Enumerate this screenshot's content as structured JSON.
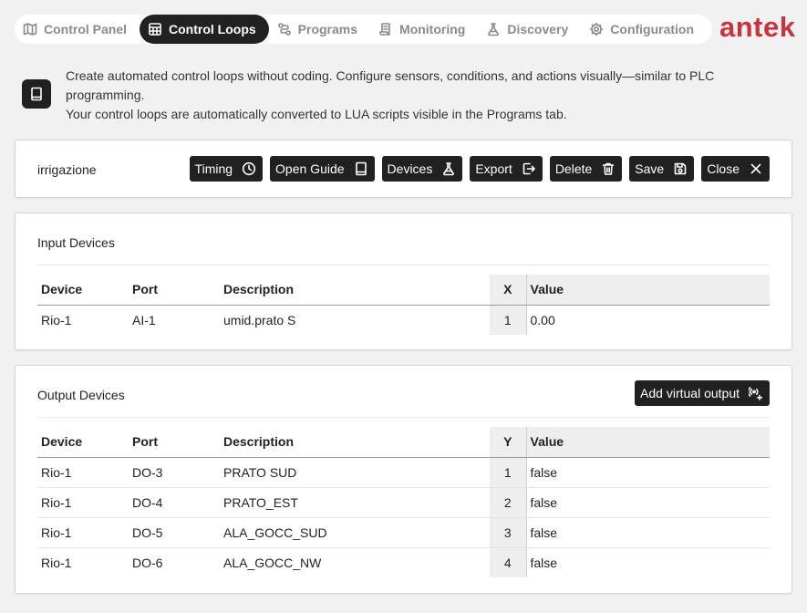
{
  "nav": {
    "tabs": [
      {
        "label": "Control Panel",
        "icon": "map-icon"
      },
      {
        "label": "Control Loops",
        "icon": "grid-icon",
        "active": true
      },
      {
        "label": "Programs",
        "icon": "workflow-icon"
      },
      {
        "label": "Monitoring",
        "icon": "scroll-icon"
      },
      {
        "label": "Discovery",
        "icon": "flask-icon"
      },
      {
        "label": "Configuration",
        "icon": "gear-icon"
      }
    ],
    "logo": "antek",
    "brand_color": "#c8343b"
  },
  "intro": {
    "line1": "Create automated control loops without coding. Configure sensors, conditions, and actions visually—similar to PLC programming.",
    "line2": "Your control loops are automatically converted to LUA scripts visible in the Programs tab."
  },
  "loop": {
    "name": "irrigazione",
    "buttons": {
      "timing": "Timing",
      "open_guide": "Open Guide",
      "devices": "Devices",
      "export": "Export",
      "delete": "Delete",
      "save": "Save",
      "close": "Close"
    }
  },
  "inputs": {
    "title": "Input Devices",
    "columns": {
      "device": "Device",
      "port": "Port",
      "description": "Description",
      "index": "X",
      "value": "Value"
    },
    "rows": [
      {
        "device": "Rio-1",
        "port": "AI-1",
        "description": "umid.prato S",
        "index": "1",
        "value": "0.00"
      }
    ]
  },
  "outputs": {
    "title": "Output Devices",
    "add_button": "Add virtual output",
    "columns": {
      "device": "Device",
      "port": "Port",
      "description": "Description",
      "index": "Y",
      "value": "Value"
    },
    "rows": [
      {
        "device": "Rio-1",
        "port": "DO-3",
        "description": "PRATO SUD",
        "index": "1",
        "value": "false"
      },
      {
        "device": "Rio-1",
        "port": "DO-4",
        "description": "PRATO_EST",
        "index": "2",
        "value": "false"
      },
      {
        "device": "Rio-1",
        "port": "DO-5",
        "description": "ALA_GOCC_SUD",
        "index": "3",
        "value": "false"
      },
      {
        "device": "Rio-1",
        "port": "DO-6",
        "description": "ALA_GOCC_NW",
        "index": "4",
        "value": "false"
      }
    ]
  }
}
